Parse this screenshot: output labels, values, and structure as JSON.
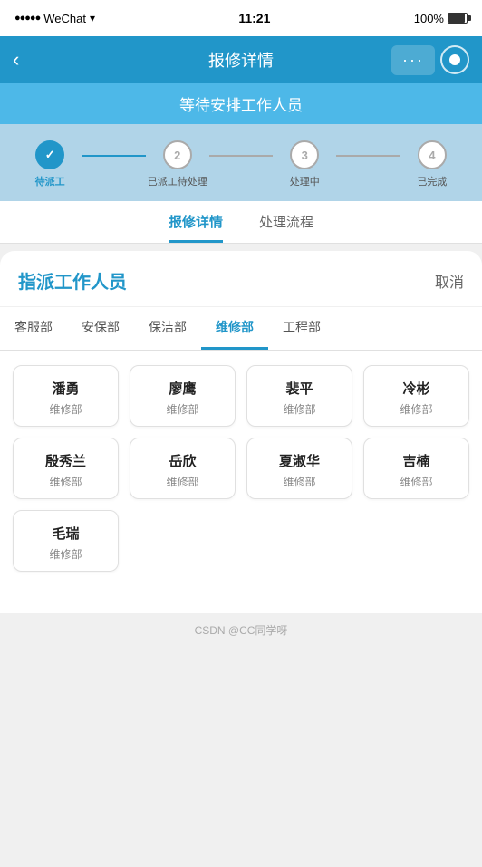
{
  "statusBar": {
    "signal": "●●●●●",
    "app": "WeChat",
    "time": "11:21",
    "battery": "100%"
  },
  "header": {
    "title": "报修详情",
    "back": "‹",
    "dotsLabel": "···"
  },
  "statusBanner": {
    "text": "等待安排工作人员"
  },
  "steps": [
    {
      "id": 1,
      "label": "待派工",
      "state": "done"
    },
    {
      "id": 2,
      "label": "已派工待处理",
      "state": "normal"
    },
    {
      "id": 3,
      "label": "处理中",
      "state": "normal"
    },
    {
      "id": 4,
      "label": "已完成",
      "state": "normal"
    }
  ],
  "tabs": [
    {
      "label": "报修详情",
      "active": true
    },
    {
      "label": "处理流程",
      "active": false
    }
  ],
  "panel": {
    "title": "指派工作人员",
    "cancel": "取消"
  },
  "deptTabs": [
    {
      "label": "客服部",
      "active": false
    },
    {
      "label": "安保部",
      "active": false
    },
    {
      "label": "保洁部",
      "active": false
    },
    {
      "label": "维修部",
      "active": true
    },
    {
      "label": "工程部",
      "active": false
    }
  ],
  "staffList": [
    {
      "name": "潘勇",
      "dept": "维修部"
    },
    {
      "name": "廖鹰",
      "dept": "维修部"
    },
    {
      "name": "裴平",
      "dept": "维修部"
    },
    {
      "name": "冷彬",
      "dept": "维修部"
    },
    {
      "name": "殷秀兰",
      "dept": "维修部"
    },
    {
      "name": "岳欣",
      "dept": "维修部"
    },
    {
      "name": "夏淑华",
      "dept": "维修部"
    },
    {
      "name": "吉楠",
      "dept": "维修部"
    },
    {
      "name": "毛瑞",
      "dept": "维修部"
    }
  ],
  "footer": {
    "text": "CSDN @CC同学呀"
  }
}
